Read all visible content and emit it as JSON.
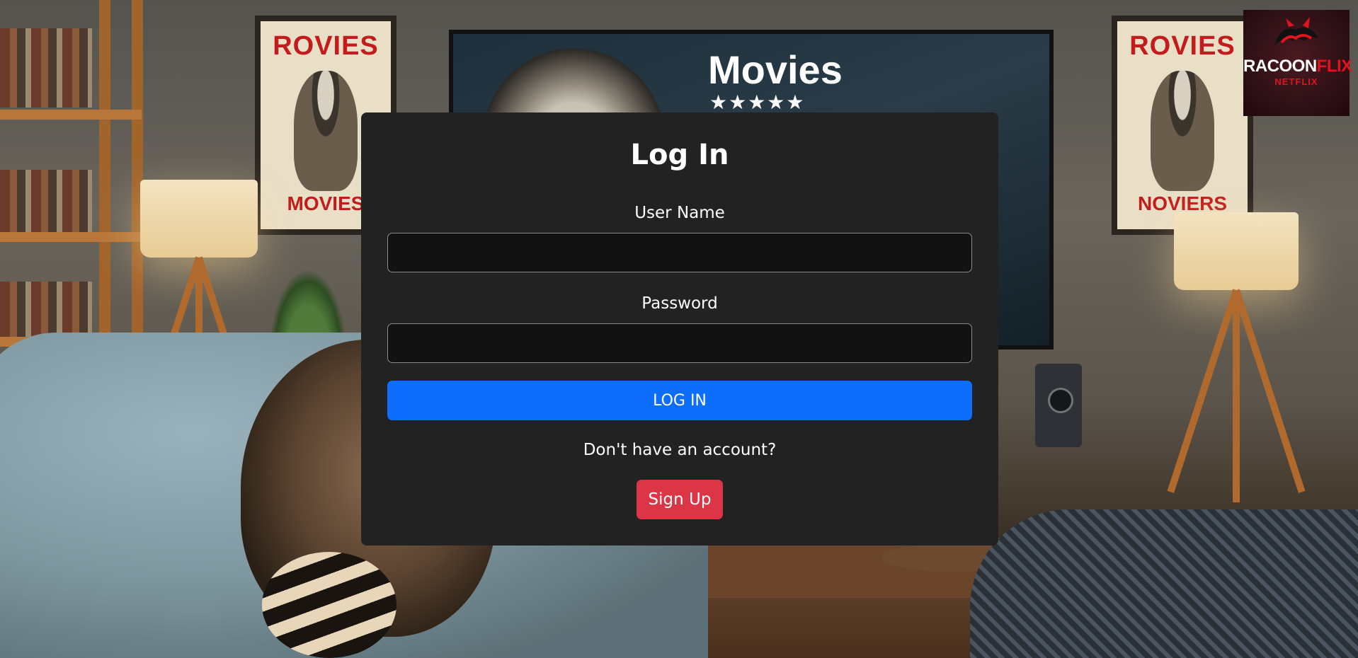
{
  "background": {
    "poster_top_text": "ROVIES",
    "poster_left_bottom_text": "MOVIES",
    "poster_right_bottom_text": "NOVIERS",
    "tv_title": "Movies",
    "tv_rating": "★★★★★"
  },
  "logo": {
    "brand_part1": "RACOON",
    "brand_part2": "FLIX",
    "sub": "NETFLIX",
    "emblem_icon": "raccoon-emblem-icon"
  },
  "login": {
    "title": "Log In",
    "username_label": "User Name",
    "username_value": "",
    "password_label": "Password",
    "password_value": "",
    "login_button": "LOG IN",
    "no_account_prompt": "Don't have an account?",
    "signup_button": "Sign Up"
  },
  "colors": {
    "card_bg": "#222222",
    "input_bg": "#121212",
    "primary": "#0d6efd",
    "danger": "#dc3545"
  }
}
